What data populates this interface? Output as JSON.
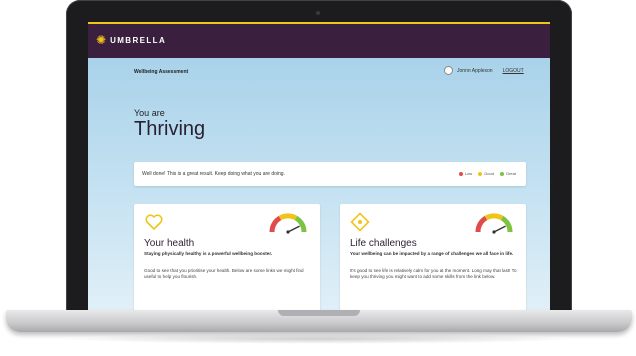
{
  "app": {
    "brand": "UMBRELLA"
  },
  "header": {
    "breadcrumb": "Wellbeing Assessment",
    "user_name": "Jonnn Appleson",
    "logout_label": "LOGOUT"
  },
  "result": {
    "prefix": "You are",
    "status": "Thriving"
  },
  "banner": {
    "message": "Well done! This is a great result. Keep doing what you are doing.",
    "legend": [
      {
        "label": "Low",
        "color": "#e04b4b"
      },
      {
        "label": "Good",
        "color": "#f0c419"
      },
      {
        "label": "Great",
        "color": "#7cc243"
      }
    ]
  },
  "cards": [
    {
      "icon": "heart-icon",
      "title": "Your health",
      "subtitle": "Staying physically healthy is a powerful wellbeing booster.",
      "body": "Good to see that you prioritise your health. Below are some links we might find useful to help you flourish.",
      "gauge_level": 0.85
    },
    {
      "icon": "diamond-icon",
      "title": "Life challenges",
      "subtitle": "Your wellbeing can be impacted by a range of challenges we all face in life.",
      "body": "It's good to see life is relatively calm for you at the moment. Long may that last! To keep you thriving you might want to add some skills from the link below.",
      "gauge_level": 0.85
    }
  ],
  "colors": {
    "header_bg": "#3a1f3f",
    "accent": "#f0c419"
  }
}
